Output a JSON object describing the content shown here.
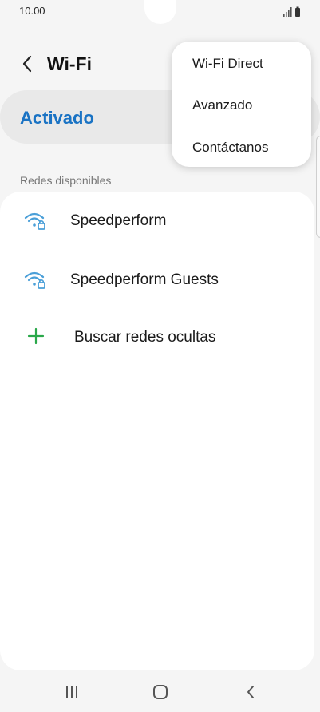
{
  "status_bar": {
    "time": "10.00",
    "signal_icon": "signal-icon",
    "battery_icon": "battery-icon"
  },
  "header": {
    "title": "Wi-Fi",
    "back_icon": "chevron-left-icon"
  },
  "toggle": {
    "label": "Activado"
  },
  "networks": {
    "section_label": "Redes disponibles",
    "items": [
      {
        "name": "Speedperform",
        "icon": "wifi-lock-icon"
      },
      {
        "name": "Speedperform Guests",
        "icon": "wifi-lock-icon"
      }
    ],
    "add_hidden_label": "Buscar redes ocultas",
    "add_icon": "plus-icon"
  },
  "overflow_menu": {
    "items": [
      {
        "label": "Wi-Fi Direct"
      },
      {
        "label": "Avanzado"
      },
      {
        "label": "Contáctanos"
      }
    ]
  },
  "nav_bar": {
    "recents_icon": "recents-icon",
    "home_icon": "home-icon",
    "back_icon": "back-icon"
  },
  "colors": {
    "accent": "#1a73c4",
    "wifi_icon": "#4a9fd8",
    "add_icon": "#2aa84a",
    "background": "#f5f5f5",
    "card": "#ffffff"
  }
}
